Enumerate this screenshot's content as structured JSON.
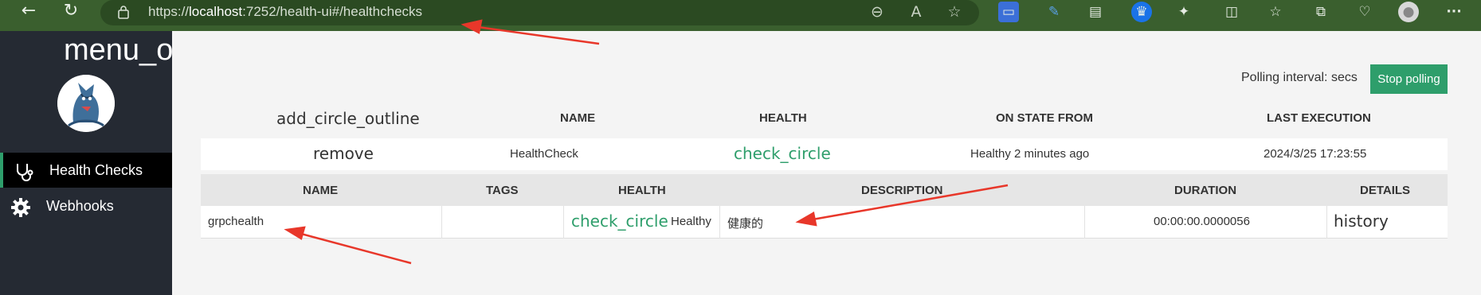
{
  "browser": {
    "url_prefix": "https://",
    "url_host": "localhost",
    "url_rest": ":7252/health-ui#/healthchecks",
    "ellipsis": "···"
  },
  "sidebar": {
    "title": "menu_o",
    "items": [
      {
        "label": "Health Checks",
        "icon": "stethoscope-icon",
        "active": true
      },
      {
        "label": "Webhooks",
        "icon": "gear-icon",
        "active": false
      }
    ]
  },
  "main": {
    "polling_label": "Polling interval: secs",
    "stop_polling_label": "Stop polling",
    "table_headers": {
      "add": "add_circle_outline",
      "name": "NAME",
      "health": "HEALTH",
      "on_state_from": "ON STATE FROM",
      "last_execution": "LAST EXECUTION"
    },
    "check_row": {
      "toggle": "remove",
      "name": "HealthCheck",
      "health_icon": "check_circle",
      "on_state_from": "Healthy 2 minutes ago",
      "last_execution": "2024/3/25 17:23:55"
    },
    "entry_headers": {
      "name": "NAME",
      "tags": "TAGS",
      "health": "HEALTH",
      "description": "DESCRIPTION",
      "duration": "DURATION",
      "details": "DETAILS"
    },
    "entries": [
      {
        "name": "grpchealth",
        "tags": "",
        "health_icon": "check_circle",
        "health": "Healthy",
        "description": "健康的",
        "duration": "00:00:00.0000056",
        "details": "history"
      }
    ]
  },
  "colors": {
    "chrome": "#3a5f2e",
    "sidebar": "#252a33",
    "accent": "#2e9e6b",
    "annotation_arrow": "#e8372a"
  }
}
